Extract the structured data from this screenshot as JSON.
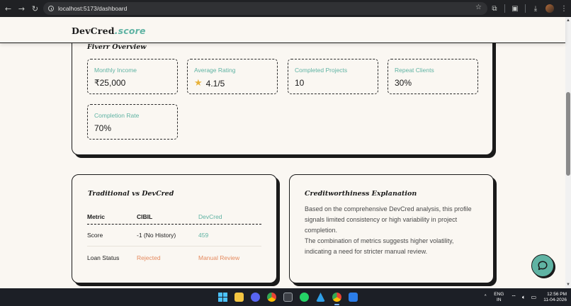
{
  "browser": {
    "url": "localhost:5173/dashboard",
    "back_icon": "back-arrow-icon",
    "forward_icon": "forward-arrow-icon",
    "reload_icon": "reload-icon"
  },
  "app": {
    "logo_main": "DevCred",
    "logo_accent": ".score"
  },
  "fiverr": {
    "title": "Fiverr Overview",
    "metrics": [
      {
        "label": "Monthly Income",
        "value": "₹25,000"
      },
      {
        "label": "Average Rating",
        "value": "4.1/5",
        "icon": "star-icon"
      },
      {
        "label": "Completed Projects",
        "value": "10"
      },
      {
        "label": "Repeat Clients",
        "value": "30%"
      },
      {
        "label": "Completion Rate",
        "value": "70%"
      }
    ]
  },
  "comparison": {
    "title": "Traditional vs DevCred",
    "headers": [
      "Metric",
      "CIBIL",
      "DevCred"
    ],
    "rows": [
      {
        "metric": "Score",
        "cibil": "-1 (No History)",
        "devcred": "459"
      },
      {
        "metric": "Loan Status",
        "cibil": "Rejected",
        "devcred": "Manual Review"
      }
    ]
  },
  "explanation": {
    "title": "Creditworthiness Explanation",
    "paragraph1": "Based on the comprehensive DevCred analysis, this profile signals limited consistency or high variability in project completion.",
    "paragraph2": "The combination of metrics suggests higher volatility, indicating a need for stricter manual review."
  },
  "taskbar": {
    "lang_line1": "ENG",
    "lang_line2": "IN",
    "time": "12:56 PM",
    "date": "11-04-2026"
  },
  "colors": {
    "accent": "#5fb3a3",
    "danger": "#e58a5e",
    "background": "#faf7f2",
    "ink": "#1a1a1a"
  }
}
